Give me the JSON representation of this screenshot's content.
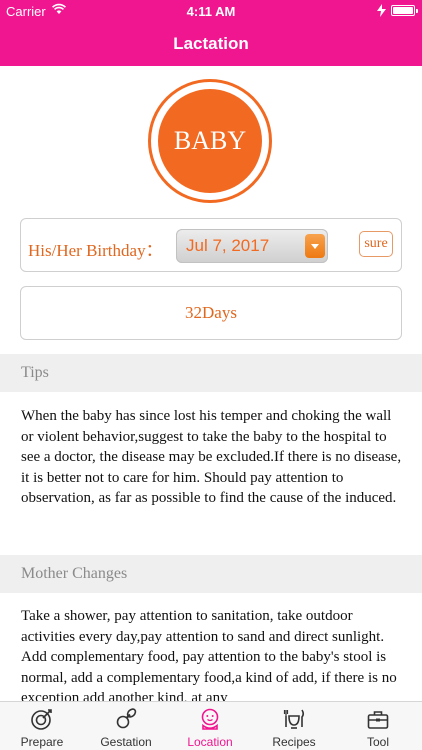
{
  "status_bar": {
    "carrier": "Carrier",
    "time": "4:11 AM"
  },
  "nav": {
    "title": "Lactation"
  },
  "avatar": {
    "label": "BABY"
  },
  "birthday": {
    "label": "His/Her Birthday：",
    "date_value": "Jul 7, 2017",
    "sure_label": "sure"
  },
  "days": {
    "value": "32Days"
  },
  "tips": {
    "header": "Tips",
    "text": "When the baby has since lost his temper and choking the wall or violent behavior,suggest to take the baby to the hospital to see a doctor, the disease may be excluded.If there is no disease, it is better not to care for him. Should pay attention to observation, as far as possible to find the cause of the induced."
  },
  "mother_changes": {
    "header": "Mother Changes",
    "text": "Take a shower, pay attention to sanitation, take outdoor activities every day,pay attention to sand and direct sunlight. Add complementary food, pay attention to the baby's stool is normal, add a complementary food,a kind of add, if there is no exception add another kind, at any"
  },
  "tabs": [
    {
      "label": "Prepare",
      "icon": "pacifier-target-icon"
    },
    {
      "label": "Gestation",
      "icon": "pacifier-icon"
    },
    {
      "label": "Location",
      "icon": "baby-face-icon",
      "active": true
    },
    {
      "label": "Recipes",
      "icon": "bowl-utensils-icon"
    },
    {
      "label": "Tool",
      "icon": "toolbox-icon"
    }
  ],
  "colors": {
    "brand_pink": "#f01690",
    "accent_orange": "#f26a21",
    "section_gray": "#efefef"
  }
}
